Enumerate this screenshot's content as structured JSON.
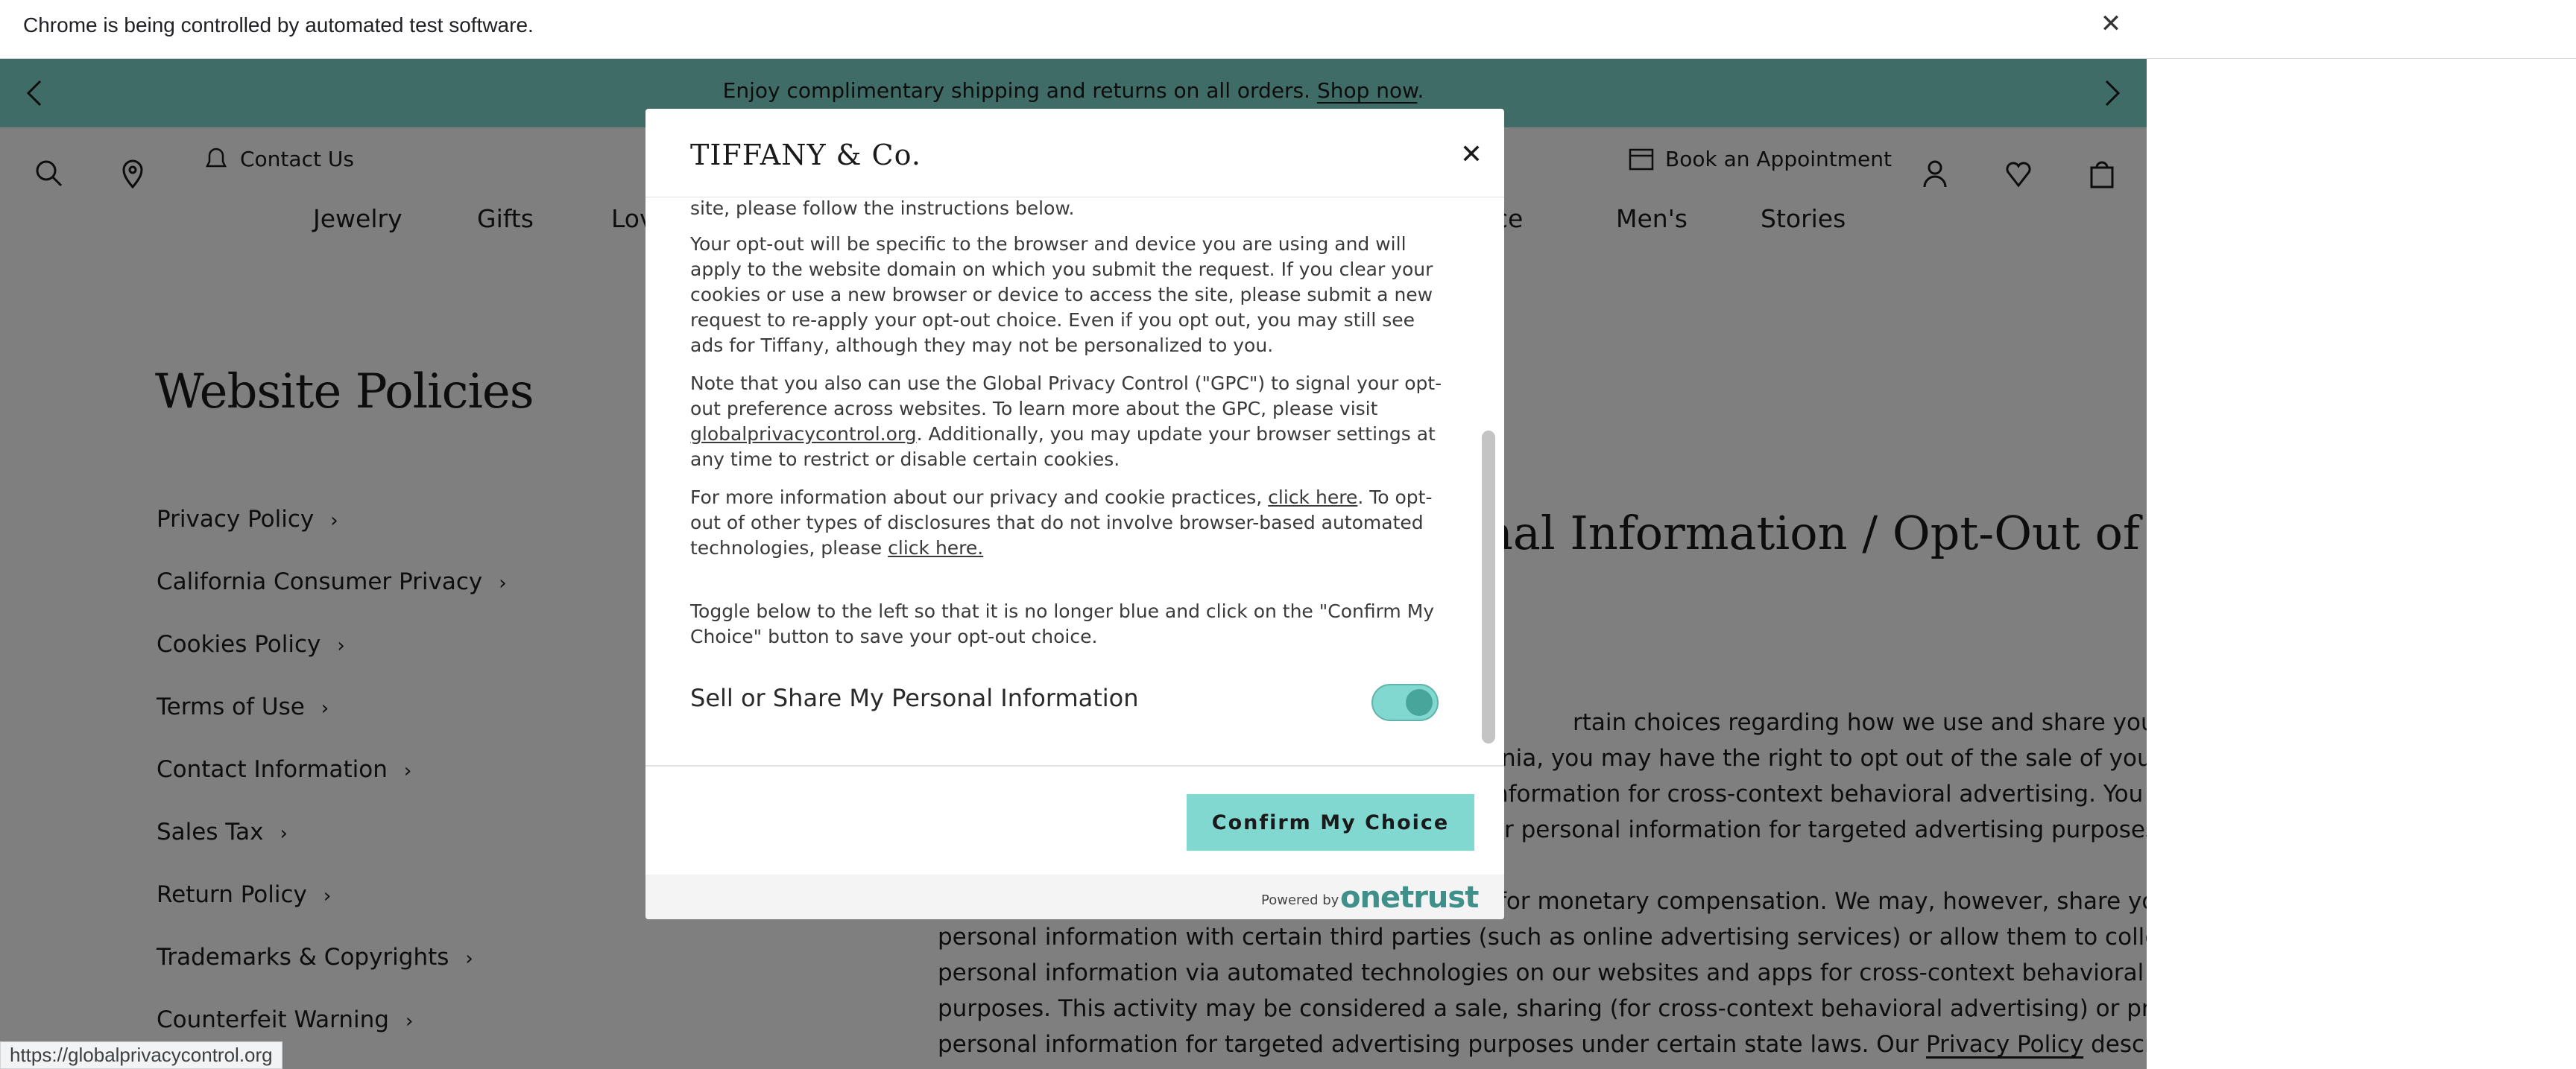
{
  "browser": {
    "infobar_message": "Chrome is being controlled by automated test software.",
    "status_url": "https://globalprivacycontrol.org"
  },
  "promo": {
    "text": "Enjoy complimentary shipping and returns on all orders.",
    "link": "Shop now",
    "trailing": "."
  },
  "header": {
    "contact_label": "Contact Us",
    "book_label": "Book an Appointment"
  },
  "nav": {
    "items": [
      "Jewelry",
      "Gifts",
      "Lov",
      "nce",
      "Men's",
      "Stories"
    ]
  },
  "sidebar": {
    "title": "Website Policies",
    "items": [
      "Privacy Policy",
      "California Consumer Privacy",
      "Cookies Policy",
      "Terms of Use",
      "Contact Information",
      "Sales Tax",
      "Return Policy",
      "Trademarks & Copyrights",
      "Counterfeit Warning"
    ]
  },
  "main": {
    "heading_fragment": "nal Information / Opt-Out of",
    "lines": [
      "rtain choices regarding how we use and share your personal",
      "nia, you may have the right to opt out of the sale of your",
      "nformation for cross-context behavioral advertising. You also",
      "r personal information for targeted advertising purposes."
    ],
    "p2_first": "for monetary compensation. We may, however, share your",
    "p2_lines": [
      "personal information with certain third parties (such as online advertising services) or allow them to collect",
      "personal information via automated technologies on our websites and apps for cross-context behavioral advertising",
      "purposes. This activity may be considered a sale, sharing (for cross-context behavioral advertising) or processing of"
    ],
    "p2_last_before": "personal information for targeted advertising purposes under certain state laws. Our ",
    "p2_link": "Privacy Policy",
    "p2_last_after": " describes the"
  },
  "modal": {
    "logo": "TIFFANY & Co.",
    "p0": "site, please follow the instructions below.",
    "p1": "Your opt-out will be specific to the browser and device you are using and will apply to the website domain on which you submit the request. If you clear your cookies or use a new browser or device to access the site, please submit a new request to re-apply your opt-out choice. Even if you opt out, you may still see ads for Tiffany, although they may not be personalized to you.",
    "p2_before": "Note that you also can use the Global Privacy Control (\"GPC\") to signal your opt-out preference across websites. To learn more about the GPC, please visit ",
    "p2_link": "globalprivacycontrol.org",
    "p2_after": ". Additionally, you may update your browser settings at any time to restrict or disable certain cookies.",
    "p3_before": "For more information about our privacy and cookie practices, ",
    "p3_link1": "click here",
    "p3_mid": ". To opt-out of other types of disclosures that do not involve browser-based automated technologies, please ",
    "p3_link2": "click here.",
    "p4": "Toggle below to the left so that it is no longer blue and click on the \"Confirm My Choice\" button to save your opt-out choice.",
    "toggle_label": "Sell or Share My Personal Information",
    "toggle_on": true,
    "confirm_label": "Confirm My Choice",
    "powered_by": "Powered by",
    "powered_brand": "onetrust"
  },
  "colors": {
    "accent": "#81d8d0",
    "overlay": "rgba(0,0,0,0.5)"
  }
}
